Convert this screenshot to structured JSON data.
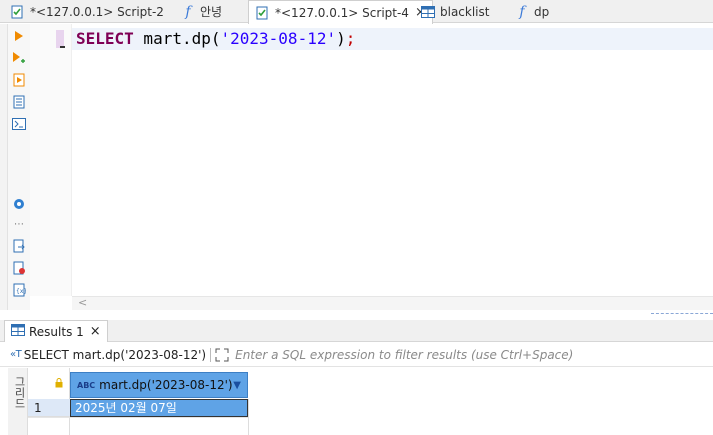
{
  "tabs": [
    {
      "label": "*<127.0.0.1> Script-2",
      "icon": "sql-script-icon"
    },
    {
      "label": "안녕",
      "icon": "function-icon"
    },
    {
      "label": "*<127.0.0.1> Script-4",
      "icon": "sql-script-icon",
      "active": true
    },
    {
      "label": "blacklist",
      "icon": "table-icon"
    },
    {
      "label": "dp",
      "icon": "function-icon"
    }
  ],
  "fn_glyph": "f",
  "close_glyph": "×",
  "editor": {
    "keyword": "SELECT",
    "call": " mart.dp(",
    "literal": "'2023-08-12'",
    "close_paren": ")",
    "semicolon": ";"
  },
  "hscroll_arrow": "<",
  "results": {
    "tab_label": "Results 1",
    "query_text": "SELECT mart.dp('2023-08-12')",
    "filter_placeholder": "Enter a SQL expression to filter results (use Ctrl+Space)",
    "column_type": "ABC",
    "column_header": "mart.dp('2023-08-12')",
    "rows": [
      {
        "num": "1",
        "value": "2025년 02월 07일"
      }
    ],
    "side_label": "그리드"
  },
  "colors": {
    "accent": "#5fa3e6",
    "keyword": "#7f0055",
    "string": "#2a00ff"
  }
}
